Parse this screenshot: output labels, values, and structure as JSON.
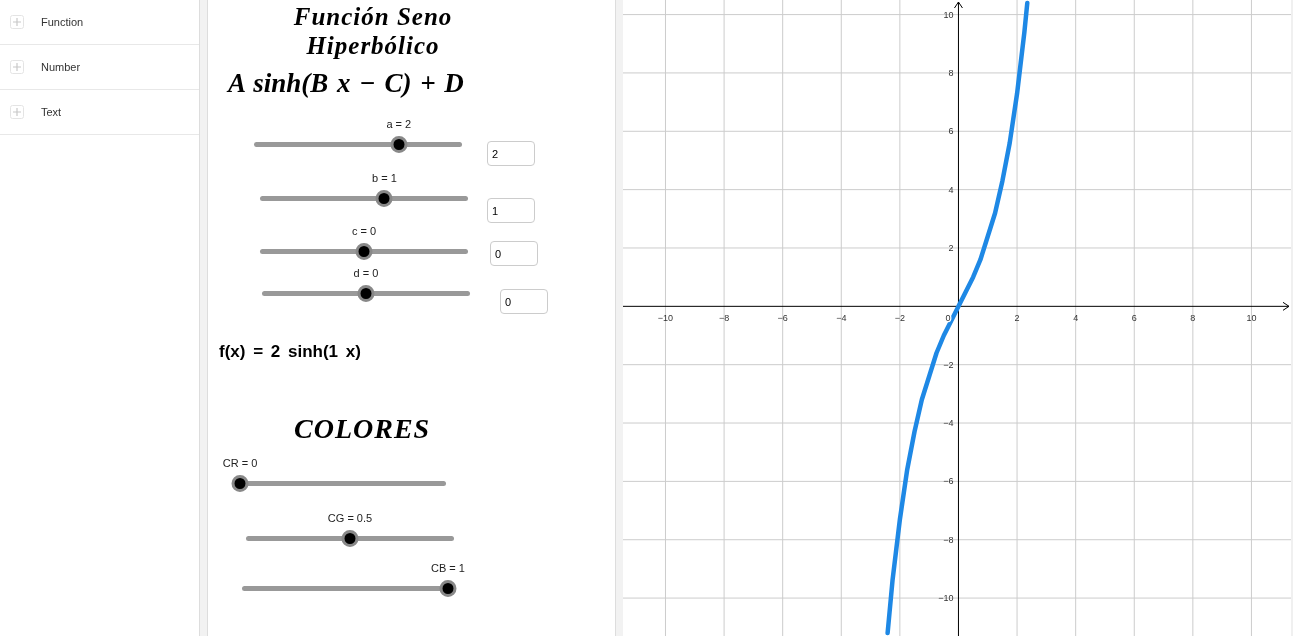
{
  "algebra": {
    "items": [
      {
        "label": "Function"
      },
      {
        "label": "Number"
      },
      {
        "label": "Text"
      }
    ]
  },
  "worksheet": {
    "title": "Función Seno Hiperbólico",
    "formula": "A sinh(B x − C) + D",
    "sliders": [
      {
        "label": "a = 2",
        "level": 0.7,
        "input": "2"
      },
      {
        "label": "b = 1",
        "level": 0.6,
        "input": "1"
      },
      {
        "label": "c = 0",
        "level": 0.5,
        "input": "0"
      },
      {
        "label": "d = 0",
        "level": 0.5,
        "input": "0"
      }
    ],
    "function_text": "f(x) = 2 sinh(1 x)",
    "colors_title": "COLORES",
    "color_sliders": [
      {
        "label": "CR = 0",
        "level": 0
      },
      {
        "label": "CG = 0.5",
        "level": 0.5
      },
      {
        "label": "CB = 1",
        "level": 1
      }
    ]
  },
  "graph": {
    "origin_label": "0",
    "chart_data": {
      "type": "line",
      "x": [
        -2.42,
        -2.25,
        -2,
        -1.75,
        -1.5,
        -1.25,
        -1,
        -0.75,
        -0.5,
        -0.25,
        0,
        0.25,
        0.5,
        0.75,
        1,
        1.25,
        1.5,
        1.75,
        2,
        2.25,
        2.35
      ],
      "series": [
        {
          "color": "#1e88e5",
          "values": [
            -11.2,
            -9.4,
            -7.3,
            -5.6,
            -4.3,
            -3.2,
            -2.4,
            -1.6,
            -1,
            -0.5,
            0,
            0.5,
            1,
            1.6,
            2.4,
            3.2,
            4.3,
            5.6,
            7.3,
            9.4,
            10.4
          ]
        }
      ],
      "grid": true,
      "xlim": [
        -11.45,
        11.35
      ],
      "ylim": [
        -11.3,
        10.5
      ],
      "xticks": [
        {
          "value": -10,
          "label": "−10"
        },
        {
          "value": -8,
          "label": "−8"
        },
        {
          "value": -6,
          "label": "−6"
        },
        {
          "value": -4,
          "label": "−4"
        },
        {
          "value": -2,
          "label": "−2"
        },
        2,
        4,
        6,
        8,
        10
      ],
      "yticks": [
        {
          "value": -10,
          "label": "−10"
        },
        {
          "value": -8,
          "label": "−8"
        },
        {
          "value": -6,
          "label": "−6"
        },
        {
          "value": -4,
          "label": "−4"
        },
        {
          "value": -2,
          "label": "−2"
        },
        2,
        4,
        6,
        8,
        10
      ]
    }
  }
}
